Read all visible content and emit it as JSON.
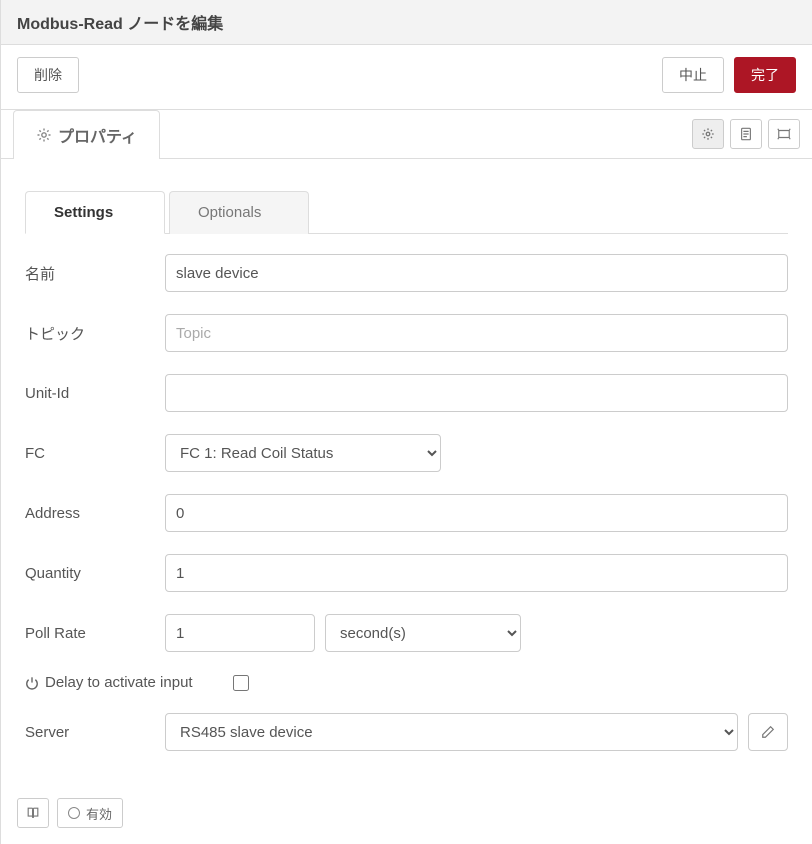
{
  "header": {
    "title": "Modbus-Read ノードを編集"
  },
  "toolbar": {
    "delete_label": "削除",
    "cancel_label": "中止",
    "done_label": "完了"
  },
  "main_tab": {
    "label": "プロパティ"
  },
  "inner_tabs": {
    "settings": "Settings",
    "optionals": "Optionals"
  },
  "form": {
    "name_label": "名前",
    "name_value": "slave device",
    "topic_label": "トピック",
    "topic_placeholder": "Topic",
    "topic_value": "",
    "unitid_label": "Unit-Id",
    "unitid_value": "",
    "fc_label": "FC",
    "fc_value": "FC 1: Read Coil Status",
    "address_label": "Address",
    "address_value": "0",
    "quantity_label": "Quantity",
    "quantity_value": "1",
    "pollrate_label": "Poll Rate",
    "pollrate_value": "1",
    "pollrate_unit": "second(s)",
    "delay_label": "Delay to activate input",
    "delay_checked": false,
    "server_label": "Server",
    "server_value": "RS485 slave device"
  },
  "footer": {
    "status_label": "有効"
  }
}
